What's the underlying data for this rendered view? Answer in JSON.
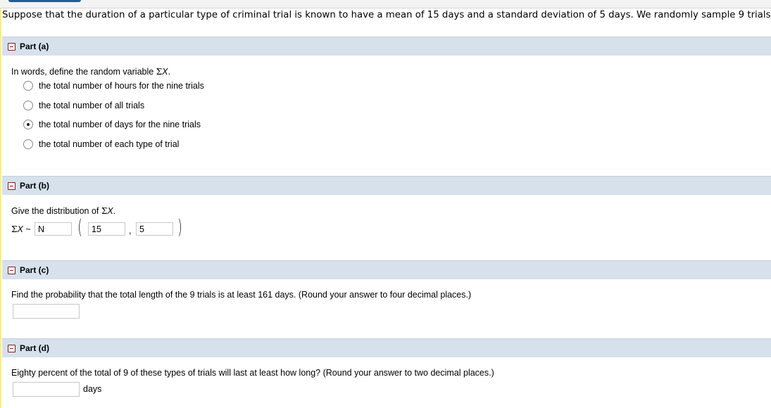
{
  "intro": "Suppose that the duration of a particular type of criminal trial is known to have a mean of 15 days and a standard deviation of 5 days. We randomly sample 9 trials.",
  "parts": {
    "a": {
      "title": "Part (a)",
      "question_prefix": "In words, define the random variable ",
      "sigma": "Σ",
      "var": "X",
      "question_suffix": ".",
      "options": [
        {
          "label": "the total number of hours for the nine trials",
          "checked": false
        },
        {
          "label": "the total number of all trials",
          "checked": false
        },
        {
          "label": "the total number of days for the nine trials",
          "checked": true
        },
        {
          "label": "the total number of each type of trial",
          "checked": false
        }
      ]
    },
    "b": {
      "title": "Part (b)",
      "question_prefix": "Give the distribution of ",
      "sigma": "Σ",
      "var": "X",
      "question_suffix": ".",
      "tilde": "~",
      "dist_value": "N",
      "mean_value": "15",
      "comma": ",",
      "sd_value": "5"
    },
    "c": {
      "title": "Part (c)",
      "question": "Find the probability that the total length of the 9 trials is at least 161 days. (Round your answer to four decimal places.)",
      "answer_value": ""
    },
    "d": {
      "title": "Part (d)",
      "question": "Eighty percent of the total of 9 of these types of trials will last at least how long? (Round your answer to two decimal places.)",
      "answer_value": "",
      "unit": "days"
    }
  }
}
